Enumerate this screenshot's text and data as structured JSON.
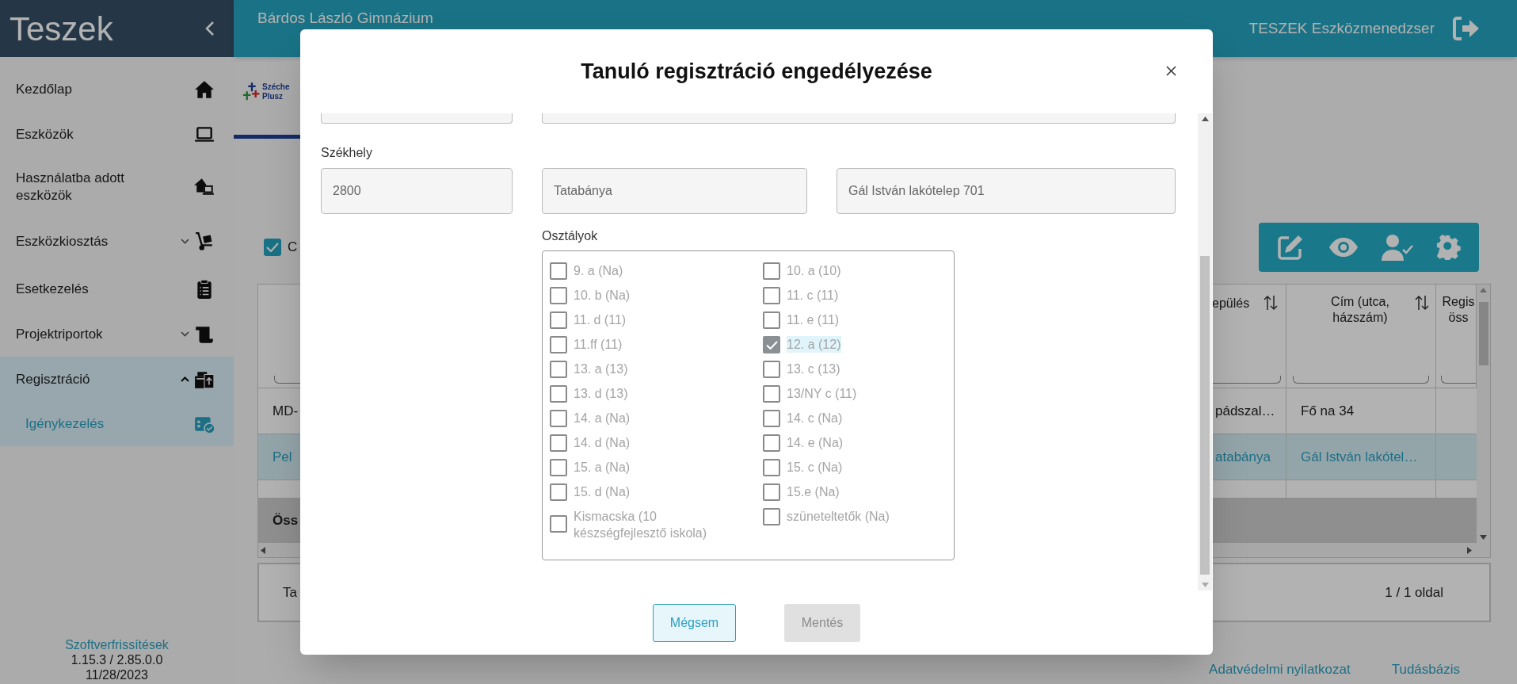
{
  "topbar": {
    "school": "Bárdos László Gimnázium",
    "app_title": "TESZEK Eszközmenedzser"
  },
  "sidebar": {
    "title": "Teszek",
    "items": [
      {
        "label": "Kezdőlap",
        "kind": "link",
        "selected": false
      },
      {
        "label": "Eszközök",
        "kind": "link",
        "selected": false
      },
      {
        "label": "Használatba adott eszközök",
        "kind": "link",
        "selected": false
      },
      {
        "label": "Eszközkiosztás",
        "kind": "group",
        "expanded": false,
        "selected": false
      },
      {
        "label": "Esetkezelés",
        "kind": "link",
        "selected": false
      },
      {
        "label": "Projektriportok",
        "kind": "group",
        "expanded": false,
        "selected": false
      },
      {
        "label": "Regisztráció",
        "kind": "group",
        "expanded": true,
        "selected": true,
        "children": [
          {
            "label": "Igénykezelés",
            "selected": true
          }
        ]
      }
    ],
    "footer": {
      "link": "Szoftverfrissítések",
      "version": "1.15.3 / 2.85.0.0",
      "date": "11/28/2023"
    }
  },
  "page": {
    "logo_lines": [
      "Széche",
      "Plusz"
    ],
    "filter_checkbox": {
      "label": "C",
      "checked": true
    },
    "table": {
      "columns": [
        "epülés",
        "Cím (utca, házszám)",
        "Regis öss"
      ],
      "rows": [
        {
          "first": "MD-",
          "settlement": "pádszal…",
          "address": "Fő na 34",
          "selected": false
        },
        {
          "first": "Pel",
          "settlement": "atabánya",
          "address": "Gál István lakótel…",
          "selected": true
        }
      ],
      "summary": "Öss",
      "footer_left": "Ta",
      "pages": "1 / 1 oldal"
    }
  },
  "footer_links": [
    "Adatvédelmi nyilatkozat",
    "Tudásbázis"
  ],
  "modal": {
    "title": "Tanuló regisztráció engedélyezése",
    "seat_label": "Székhely",
    "seat_fields": [
      "2800",
      "Tatabánya",
      "Gál István lakótelep 701"
    ],
    "classes_label": "Osztályok",
    "classes": [
      {
        "label": "9. a (Na)",
        "checked": false,
        "focused": false,
        "disabled": true
      },
      {
        "label": "10. a (10)",
        "checked": false,
        "focused": false,
        "disabled": true
      },
      {
        "label": "10. b (Na)",
        "checked": false,
        "focused": false,
        "disabled": true
      },
      {
        "label": "11. c (11)",
        "checked": false,
        "focused": false,
        "disabled": true
      },
      {
        "label": "11. d (11)",
        "checked": false,
        "focused": false,
        "disabled": true
      },
      {
        "label": "11. e (11)",
        "checked": false,
        "focused": false,
        "disabled": true
      },
      {
        "label": "11.ff (11)",
        "checked": false,
        "focused": false,
        "disabled": true
      },
      {
        "label": "12. a (12)",
        "checked": true,
        "focused": true,
        "disabled": true
      },
      {
        "label": "13. a (13)",
        "checked": false,
        "focused": false,
        "disabled": true
      },
      {
        "label": "13. c (13)",
        "checked": false,
        "focused": false,
        "disabled": true
      },
      {
        "label": "13. d (13)",
        "checked": false,
        "focused": false,
        "disabled": true
      },
      {
        "label": "13/NY c (11)",
        "checked": false,
        "focused": false,
        "disabled": true
      },
      {
        "label": "14. a (Na)",
        "checked": false,
        "focused": false,
        "disabled": true
      },
      {
        "label": "14. c (Na)",
        "checked": false,
        "focused": false,
        "disabled": true
      },
      {
        "label": "14. d (Na)",
        "checked": false,
        "focused": false,
        "disabled": true
      },
      {
        "label": "14. e (Na)",
        "checked": false,
        "focused": false,
        "disabled": true
      },
      {
        "label": "15. a (Na)",
        "checked": false,
        "focused": false,
        "disabled": true
      },
      {
        "label": "15. c (Na)",
        "checked": false,
        "focused": false,
        "disabled": true
      },
      {
        "label": "15. d (Na)",
        "checked": false,
        "focused": false,
        "disabled": true
      },
      {
        "label": "15.e (Na)",
        "checked": false,
        "focused": false,
        "disabled": true
      },
      {
        "label": "Kismacska (10 készségfejlesztő iskola)",
        "checked": false,
        "focused": false,
        "disabled": true
      },
      {
        "label": "szüneteltetők (Na)",
        "checked": false,
        "focused": false,
        "disabled": true
      }
    ],
    "buttons": [
      {
        "label": "Mégsem",
        "kind": "secondary",
        "disabled": false
      },
      {
        "label": "Mentés",
        "kind": "primary",
        "disabled": true
      }
    ]
  }
}
